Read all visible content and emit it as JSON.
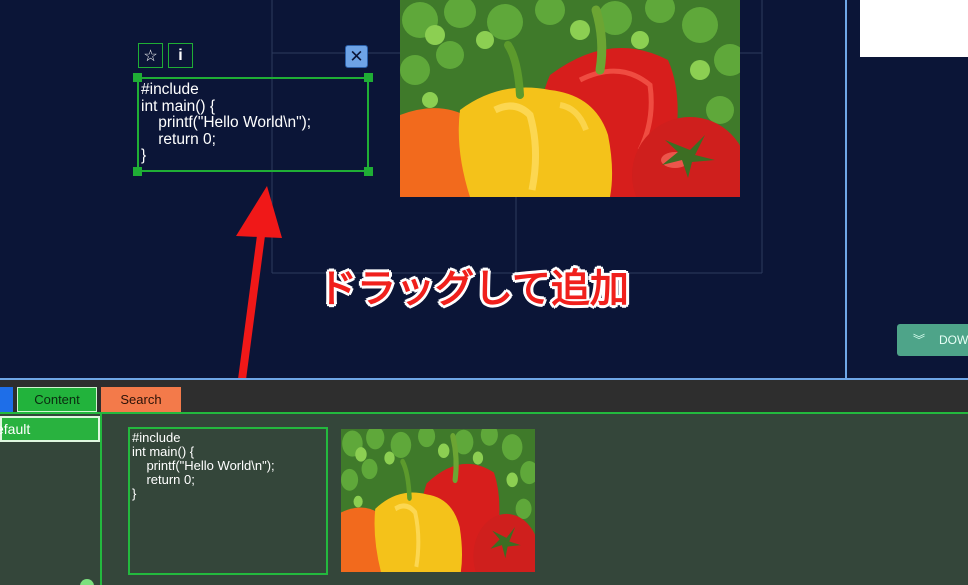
{
  "canvas": {
    "code_card": {
      "text": "#include\nint main() {\n    printf(\"Hello World\\n\");\n    return 0;\n}"
    },
    "toolbar": {
      "star_label": "☆",
      "info_label": "i",
      "close_label": "✕"
    },
    "annotation": "ドラッグして追加"
  },
  "right_panel": {
    "download_label": "DOW",
    "download_icon": "chevron-double-down-icon"
  },
  "dock": {
    "tabs": [
      {
        "label": ""
      },
      {
        "label": "Content"
      },
      {
        "label": "Search"
      }
    ],
    "sidebar": {
      "items": [
        {
          "label": "efault"
        }
      ]
    },
    "code_item": {
      "text": "#include\nint main() {\n    printf(\"Hello World\\n\");\n    return 0;\n}"
    }
  },
  "colors": {
    "canvas_bg": "#0b1537",
    "accent_green": "#23b93e",
    "accent_blue": "#6fa6e6",
    "annotation_red": "#f0201c"
  }
}
